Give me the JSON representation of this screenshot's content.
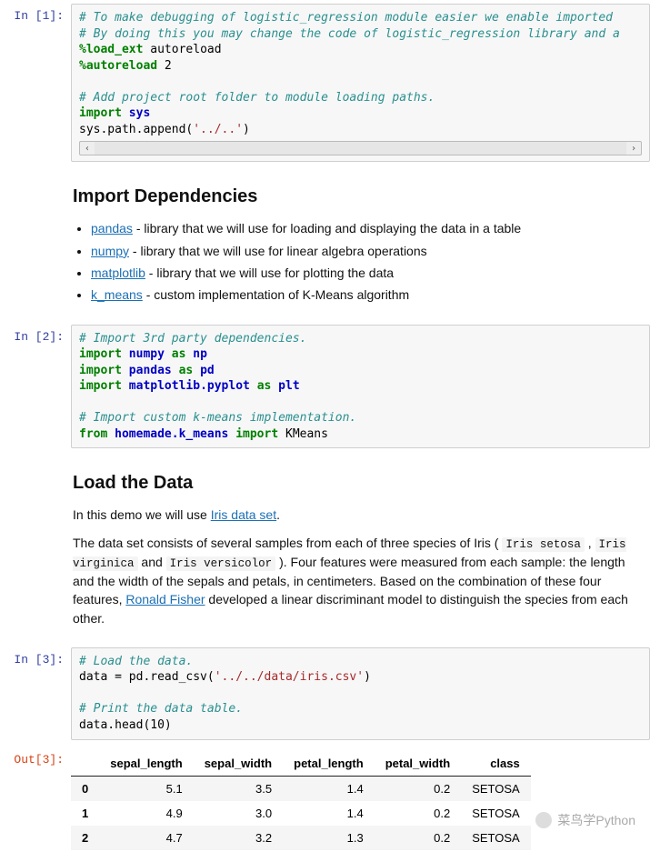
{
  "cells": {
    "c1": {
      "prompt": "In [1]:",
      "code": {
        "l1": "# To make debugging of logistic_regression module easier we enable imported ",
        "l2": "# By doing this you may change the code of logistic_regression library and a",
        "l3a": "%load_ext",
        "l3b": " autoreload",
        "l4a": "%autoreload",
        "l4b": " 2",
        "l5": "# Add project root folder to module loading paths.",
        "l6a": "import",
        "l6b": " sys",
        "l7a": "sys.path.append(",
        "l7b": "'../..'",
        "l7c": ")"
      }
    },
    "md1": {
      "title": "Import Dependencies",
      "items": [
        {
          "link": "pandas",
          "desc": " - library that we will use for loading and displaying the data in a table"
        },
        {
          "link": "numpy",
          "desc": " - library that we will use for linear algebra operations"
        },
        {
          "link": "matplotlib",
          "desc": " - library that we will use for plotting the data"
        },
        {
          "link": "k_means",
          "desc": " - custom implementation of K-Means algorithm"
        }
      ]
    },
    "c2": {
      "prompt": "In [2]:",
      "code": {
        "l1": "# Import 3rd party dependencies.",
        "l2": "numpy",
        "l2as": "np",
        "l3": "pandas",
        "l3as": "pd",
        "l4": "matplotlib.pyplot",
        "l4as": "plt",
        "l5": "# Import custom k-means implementation.",
        "l6from": "homemade.k_means",
        "l6imp": "KMeans",
        "kw_import": "import",
        "kw_as": "as",
        "kw_from": "from"
      }
    },
    "md2": {
      "title": "Load the Data",
      "p1a": "In this demo we will use ",
      "p1link": "Iris data set",
      "p1b": ".",
      "p2a": "The data set consists of several samples from each of three species of Iris ( ",
      "sp1": "Iris setosa",
      "p2b": " , ",
      "sp2": "Iris virginica",
      "p2c": " and ",
      "sp3": "Iris versicolor",
      "p2d": " ). Four features were measured from each sample: the length and the width of the sepals and petals, in centimeters. Based on the combination of these four features, ",
      "p2link": "Ronald Fisher",
      "p2e": " developed a linear discriminant model to distinguish the species from each other."
    },
    "c3": {
      "prompt": "In [3]:",
      "code": {
        "l1": "# Load the data.",
        "l2a": "data = pd.read_csv(",
        "l2b": "'../../data/iris.csv'",
        "l2c": ")",
        "l3": "# Print the data table.",
        "l4": "data.head(10)"
      }
    },
    "out3": {
      "prompt": "Out[3]:",
      "headers": [
        "",
        "sepal_length",
        "sepal_width",
        "petal_length",
        "petal_width",
        "class"
      ],
      "rows": [
        [
          "0",
          "5.1",
          "3.5",
          "1.4",
          "0.2",
          "SETOSA"
        ],
        [
          "1",
          "4.9",
          "3.0",
          "1.4",
          "0.2",
          "SETOSA"
        ],
        [
          "2",
          "4.7",
          "3.2",
          "1.3",
          "0.2",
          "SETOSA"
        ]
      ]
    }
  },
  "watermark": "菜鸟学Python"
}
